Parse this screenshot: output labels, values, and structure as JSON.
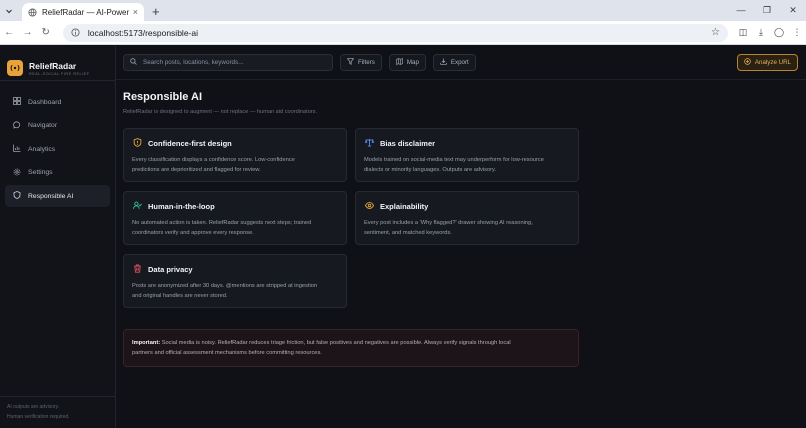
{
  "browser": {
    "tab_title": "ReliefRadar — AI-Powered Foc",
    "url": "localhost:5173/responsible-ai",
    "new_tab": "+",
    "tab_close": "×"
  },
  "sidebar": {
    "brand_name": "ReliefRadar",
    "brand_sub": "REAL-SOCIAL FIRE RELIEF",
    "items": [
      {
        "label": "Dashboard",
        "icon": "grid-icon"
      },
      {
        "label": "Navigator",
        "icon": "chat-icon"
      },
      {
        "label": "Analytics",
        "icon": "chart-icon"
      },
      {
        "label": "Settings",
        "icon": "gear-icon"
      },
      {
        "label": "Responsible AI",
        "icon": "shield-icon",
        "active": true
      }
    ],
    "footer_line1": "AI outputs are advisory.",
    "footer_line2": "Human verification required."
  },
  "topbar": {
    "search_placeholder": "Search posts, locations, keywords...",
    "filters_label": "Filters",
    "map_label": "Map",
    "export_label": "Export",
    "analyze_label": "Analyze URL"
  },
  "page": {
    "title": "Responsible AI",
    "subtitle": "ReliefRadar is designed to augment — not replace — human aid coordinators.",
    "cards": [
      {
        "title": "Confidence-first design",
        "icon": "shield-icon",
        "color": "#e8a33a",
        "line1": "Every classification displays a confidence score. Low-confidence",
        "line2": "predictions are deprioritized and flagged for review."
      },
      {
        "title": "Bias disclaimer",
        "icon": "scale-icon",
        "color": "#5b8def",
        "line1": "Models trained on social-media text may underperform for low-resource",
        "line2": "dialects or minority languages. Outputs are advisory."
      },
      {
        "title": "Human-in-the-loop",
        "icon": "users-icon",
        "color": "#2fbf8f",
        "line1": "No automated action is taken. ReliefRadar suggests next steps; trained",
        "line2": "coordinators verify and approve every response."
      },
      {
        "title": "Explainability",
        "icon": "eye-icon",
        "color": "#e8a33a",
        "line1": "Every post includes a 'Why flagged?' drawer showing AI reasoning,",
        "line2": "sentiment, and matched keywords."
      },
      {
        "title": "Data privacy",
        "icon": "trash-icon",
        "color": "#e0525c",
        "line1": "Posts are anonymized after 30 days. @mentions are stripped at ingestion",
        "line2": "and original handles are never stored."
      }
    ],
    "notice_strong": "Important:",
    "notice_line1": "Social media is noisy. ReliefRadar reduces triage friction, but false positives and negatives are possible. Always verify signals through local",
    "notice_line2": "partners and official assessment mechanisms before committing resources."
  }
}
